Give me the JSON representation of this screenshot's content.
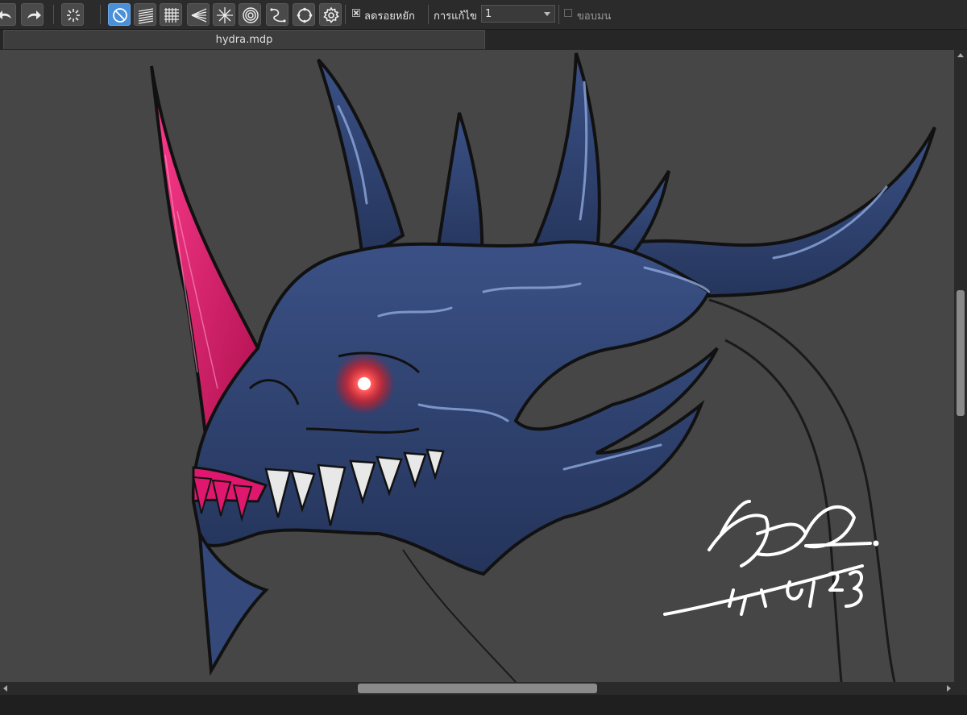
{
  "toolbar": {
    "undo_icon": "undo-icon",
    "redo_icon": "redo-icon",
    "snap_off_icon": "snap-off-icon",
    "no_snap_icon": "no-snap-icon",
    "parallel_snap_icon": "parallel-snap-icon",
    "grid_snap_icon": "grid-snap-icon",
    "perspective_snap_icon": "perspective-snap-icon",
    "radial_snap_icon": "radial-snap-icon",
    "concentric_snap_icon": "concentric-snap-icon",
    "curve_snap_icon": "curve-snap-icon",
    "circle_snap_icon": "circle-snap-icon",
    "snap_settings_icon": "gear-icon",
    "stabilizer_label": "ลดรอยหยัก",
    "stabilizer_checked": true,
    "correction_label": "การแก้ไข",
    "correction_value": "1",
    "edge_label": "ขอบมน",
    "edge_checked": false
  },
  "tab": {
    "title": "hydra.mdp"
  },
  "canvas": {
    "artwork": "dragon-head-painting",
    "colors": {
      "background": "#464646",
      "scale": "#2e3f66",
      "scale_highlight": "#5a7ab8",
      "horn_pink": "#e0176e",
      "eye": "#ff2a2a",
      "teeth": "#e8e8e8",
      "signature": "#ffffff"
    }
  },
  "scrollbars": {
    "vertical_position": 0.38,
    "horizontal_position": 0.37
  }
}
